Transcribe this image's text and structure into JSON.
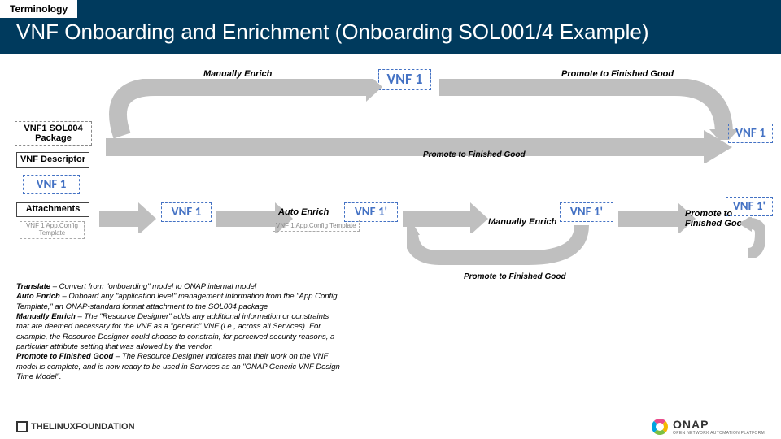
{
  "header": {
    "tab": "Terminology",
    "title": "VNF Onboarding and Enrichment (Onboarding SOL001/4 Example)"
  },
  "labels": {
    "manually_enrich_top": "Manually Enrich",
    "promote_top": "Promote to Finished Good",
    "promote_mid": "Promote to Finished Good",
    "translate": "Translate",
    "auto_enrich": "Auto Enrich",
    "manually_enrich_bottom": "Manually Enrich",
    "promote_bottom_right": "Promote to Finished Good",
    "promote_bottom_diag": "Promote to Finished Good"
  },
  "left": {
    "package": "VNF1 SOL004 Package",
    "descriptor": "VNF Descriptor",
    "vnf1": "VNF 1",
    "attachments": "Attachments",
    "attach_item": "VNF 1 App.Config Template"
  },
  "tokens": {
    "vnf1_a": "VNF 1",
    "vnf1_b": "VNF 1",
    "vnf1_c": "VNF 1",
    "vnf1p_a": "VNF 1'",
    "vnf1p_b": "VNF 1'",
    "vnf1p_c": "VNF 1'",
    "attach_small": "VNF 1 App.Config Template"
  },
  "notes": {
    "t1b": "Translate",
    "t1": " – Convert from \"onboarding\" model to ONAP internal model",
    "t2b": "Auto Enrich",
    "t2": " – Onboard any \"application level\" management information from the \"App.Config Template,\" an ONAP-standard format attachment to the SOL004 package",
    "t3b": "Manually Enrich",
    "t3": " – The \"Resource Designer\" adds any additional information or constraints that are deemed necessary for the VNF as a \"generic\" VNF (i.e., across all Services). For example, the Resource Designer could choose to constrain, for perceived security reasons, a particular attribute setting that was allowed by the vendor.",
    "t4b": "Promote to Finished Good",
    "t4": " – The Resource Designer indicates that their work on the VNF model is complete, and is now ready to be used in Services as an \"ONAP Generic VNF Design Time Model\"."
  },
  "footer": {
    "lf": "THELINUXFOUNDATION",
    "onap": "ONAP",
    "onap_sub": "OPEN NETWORK AUTOMATION PLATFORM"
  }
}
